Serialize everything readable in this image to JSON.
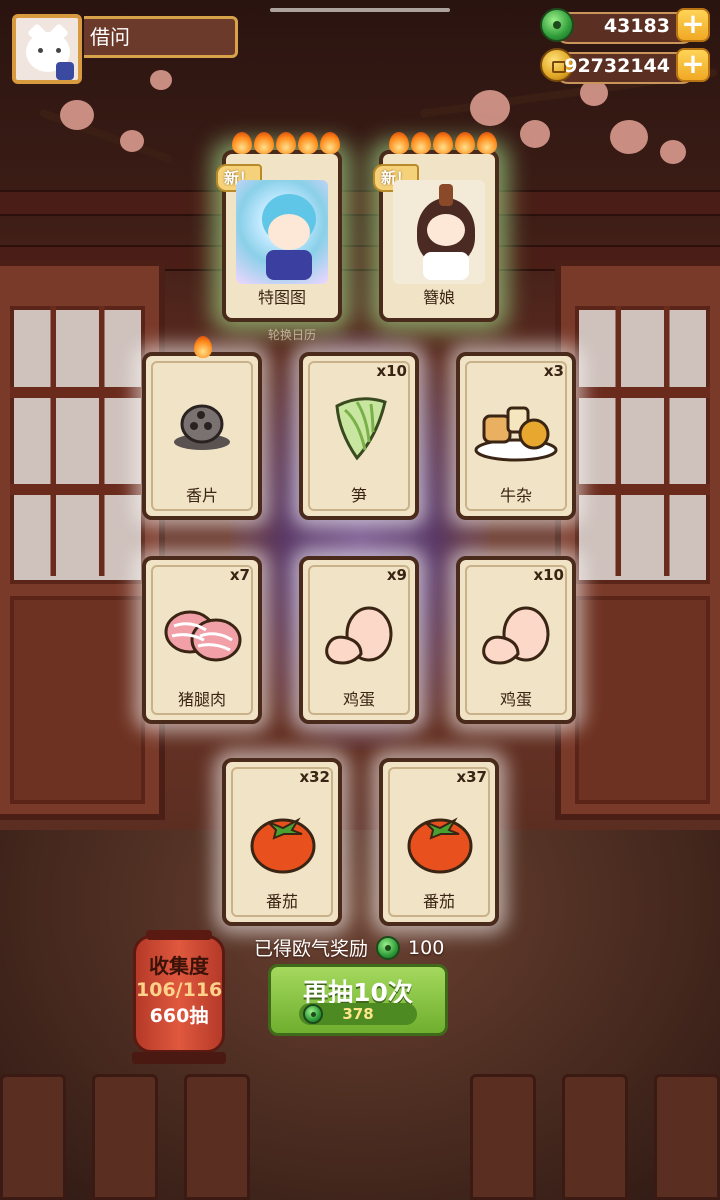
{
  "player": {
    "name": "借问"
  },
  "currencies": {
    "jade": {
      "value": "43183",
      "icon": "jade-coin-icon"
    },
    "gold": {
      "value": "92732144",
      "icon": "gold-coin-icon"
    }
  },
  "featured": [
    {
      "name": "特图图",
      "tag": "新！",
      "stars": 5
    },
    {
      "name": "簪娘",
      "tag": "新！",
      "stars": 5
    }
  ],
  "rotate_label": "轮换日历",
  "items": [
    {
      "name": "香片",
      "count": "",
      "flame": true,
      "icon": "incense-icon"
    },
    {
      "name": "笋",
      "count": "x10",
      "icon": "bamboo-shoot-icon"
    },
    {
      "name": "牛杂",
      "count": "x3",
      "icon": "beef-offal-icon"
    },
    {
      "name": "猪腿肉",
      "count": "x7",
      "icon": "pork-icon"
    },
    {
      "name": "鸡蛋",
      "count": "x9",
      "icon": "egg-icon"
    },
    {
      "name": "鸡蛋",
      "count": "x10",
      "icon": "egg-icon"
    },
    {
      "name": "番茄",
      "count": "x32",
      "icon": "tomato-icon"
    },
    {
      "name": "番茄",
      "count": "x37",
      "icon": "tomato-icon"
    }
  ],
  "reward": {
    "label": "已得欧气奖励",
    "value": "100"
  },
  "collection": {
    "title": "收集度",
    "progress": "106/116",
    "draws": "660抽"
  },
  "draw_button": {
    "label": "再抽10次",
    "cost": "378"
  }
}
